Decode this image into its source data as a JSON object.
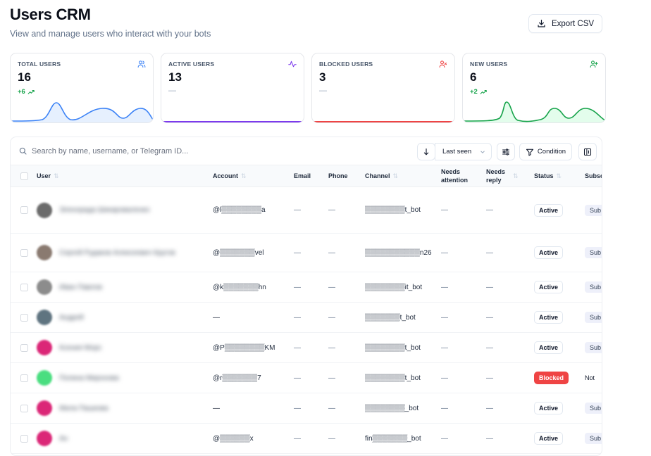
{
  "header": {
    "title": "Users CRM",
    "subtitle": "View and manage users who interact with your bots",
    "export_label": "Export CSV"
  },
  "stats": [
    {
      "label": "TOTAL USERS",
      "value": "16",
      "delta": "+6",
      "color": "#3b82f6",
      "icon": "users-icon"
    },
    {
      "label": "ACTIVE USERS",
      "value": "13",
      "delta": "—",
      "color": "#7c3aed",
      "icon": "activity-icon"
    },
    {
      "label": "BLOCKED USERS",
      "value": "3",
      "delta": "—",
      "color": "#ef4444",
      "icon": "user-x-icon"
    },
    {
      "label": "NEW USERS",
      "value": "6",
      "delta": "+2",
      "color": "#16a34a",
      "icon": "user-plus-icon"
    }
  ],
  "toolbar": {
    "search_placeholder": "Search by name, username, or Telegram ID...",
    "sort_label": "Last seen",
    "condition_label": "Condition"
  },
  "columns": {
    "user": "User",
    "account": "Account",
    "email": "Email",
    "phone": "Phone",
    "channel": "Channel",
    "needs_attention": "Needs attention",
    "needs_reply": "Needs reply",
    "status": "Status",
    "subscription": "Subsc"
  },
  "rows": [
    {
      "name": "Эленорада Шикароваленко",
      "account": "@l▒▒▒▒▒▒▒▒a",
      "email": "—",
      "phone": "—",
      "channel": "▒▒▒▒▒▒▒▒t_bot",
      "attention": "—",
      "reply": "—",
      "status": "Active",
      "sub": "Sub",
      "avatar": "#6b6b6b"
    },
    {
      "name": "Сергей Рудаков Алексеевич Кругов",
      "account": "@▒▒▒▒▒▒▒vel",
      "email": "—",
      "phone": "—",
      "channel": "▒▒▒▒▒▒▒▒▒▒▒n26",
      "attention": "—",
      "reply": "—",
      "status": "Active",
      "sub": "Sub",
      "avatar": "#8a7a70"
    },
    {
      "name": "Иван Павлов",
      "account": "@k▒▒▒▒▒▒▒hn",
      "email": "—",
      "phone": "—",
      "channel": "▒▒▒▒▒▒▒▒it_bot",
      "attention": "—",
      "reply": "—",
      "status": "Active",
      "sub": "Sub",
      "avatar": "#8c8c8c"
    },
    {
      "name": "Андрей",
      "account": "—",
      "email": "—",
      "phone": "—",
      "channel": "▒▒▒▒▒▒▒t_bot",
      "attention": "—",
      "reply": "—",
      "status": "Active",
      "sub": "Sub",
      "avatar": "#5f7480"
    },
    {
      "name": "Ксения Морс",
      "account": "@P▒▒▒▒▒▒▒▒KM",
      "email": "—",
      "phone": "—",
      "channel": "▒▒▒▒▒▒▒▒t_bot",
      "attention": "—",
      "reply": "—",
      "status": "Active",
      "sub": "Sub",
      "avatar": "#db2777"
    },
    {
      "name": "Полина Миронова",
      "account": "@r▒▒▒▒▒▒▒7",
      "email": "—",
      "phone": "—",
      "channel": "▒▒▒▒▒▒▒▒t_bot",
      "attention": "—",
      "reply": "—",
      "status": "Blocked",
      "sub": "Not",
      "avatar": "#4ade80"
    },
    {
      "name": "Мила Пашкова",
      "account": "—",
      "email": "—",
      "phone": "—",
      "channel": "▒▒▒▒▒▒▒▒_bot",
      "attention": "—",
      "reply": "—",
      "status": "Active",
      "sub": "Sub",
      "avatar": "#db2777"
    },
    {
      "name": "Ан",
      "account": "@▒▒▒▒▒▒x",
      "email": "—",
      "phone": "—",
      "channel": "fin▒▒▒▒▒▒▒_bot",
      "attention": "—",
      "reply": "—",
      "status": "Active",
      "sub": "Sub",
      "avatar": "#db2777"
    }
  ]
}
